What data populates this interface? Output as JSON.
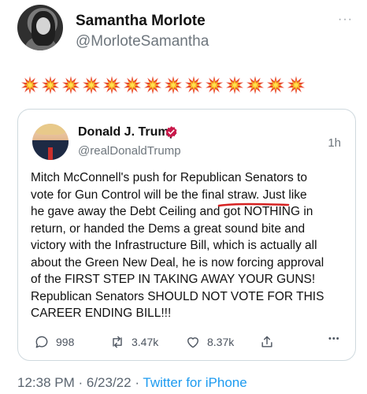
{
  "outer_tweet": {
    "name": "Samantha Morlote",
    "handle": "@MorloteSamantha",
    "more_label": "···",
    "emoji": [
      "collision-icon",
      "collision-icon",
      "collision-icon",
      "collision-icon",
      "collision-icon",
      "collision-icon",
      "collision-icon",
      "collision-icon",
      "collision-icon",
      "collision-icon",
      "collision-icon",
      "collision-icon",
      "collision-icon",
      "collision-icon"
    ]
  },
  "quoted_tweet": {
    "name": "Donald J. Trump",
    "handle": "@realDonaldTrump",
    "time": "1h",
    "verified_color": "#c9184a",
    "lines": [
      "Mitch McConnell's push for Republican Senators to",
      "vote for Gun Control will be the final straw. Just like",
      "he gave away the Debt Ceiling and got NOTHING in",
      "return, or handed the Dems a great sound bite and",
      "victory with the Infrastructure Bill, which is actually all",
      "about the Green New Deal, he is now forcing approval",
      "of the FIRST STEP IN TAKING AWAY YOUR GUNS!",
      "Republican Senators SHOULD NOT VOTE FOR THIS",
      "CAREER ENDING BILL!!!"
    ],
    "annotation_color": "#d62222",
    "actions": {
      "replies": "998",
      "retweets": "3.47k",
      "likes": "8.37k",
      "more_label": "•••"
    }
  },
  "footer": {
    "timestamp": "12:38 PM · 6/23/22 · ",
    "source": "Twitter for iPhone"
  }
}
